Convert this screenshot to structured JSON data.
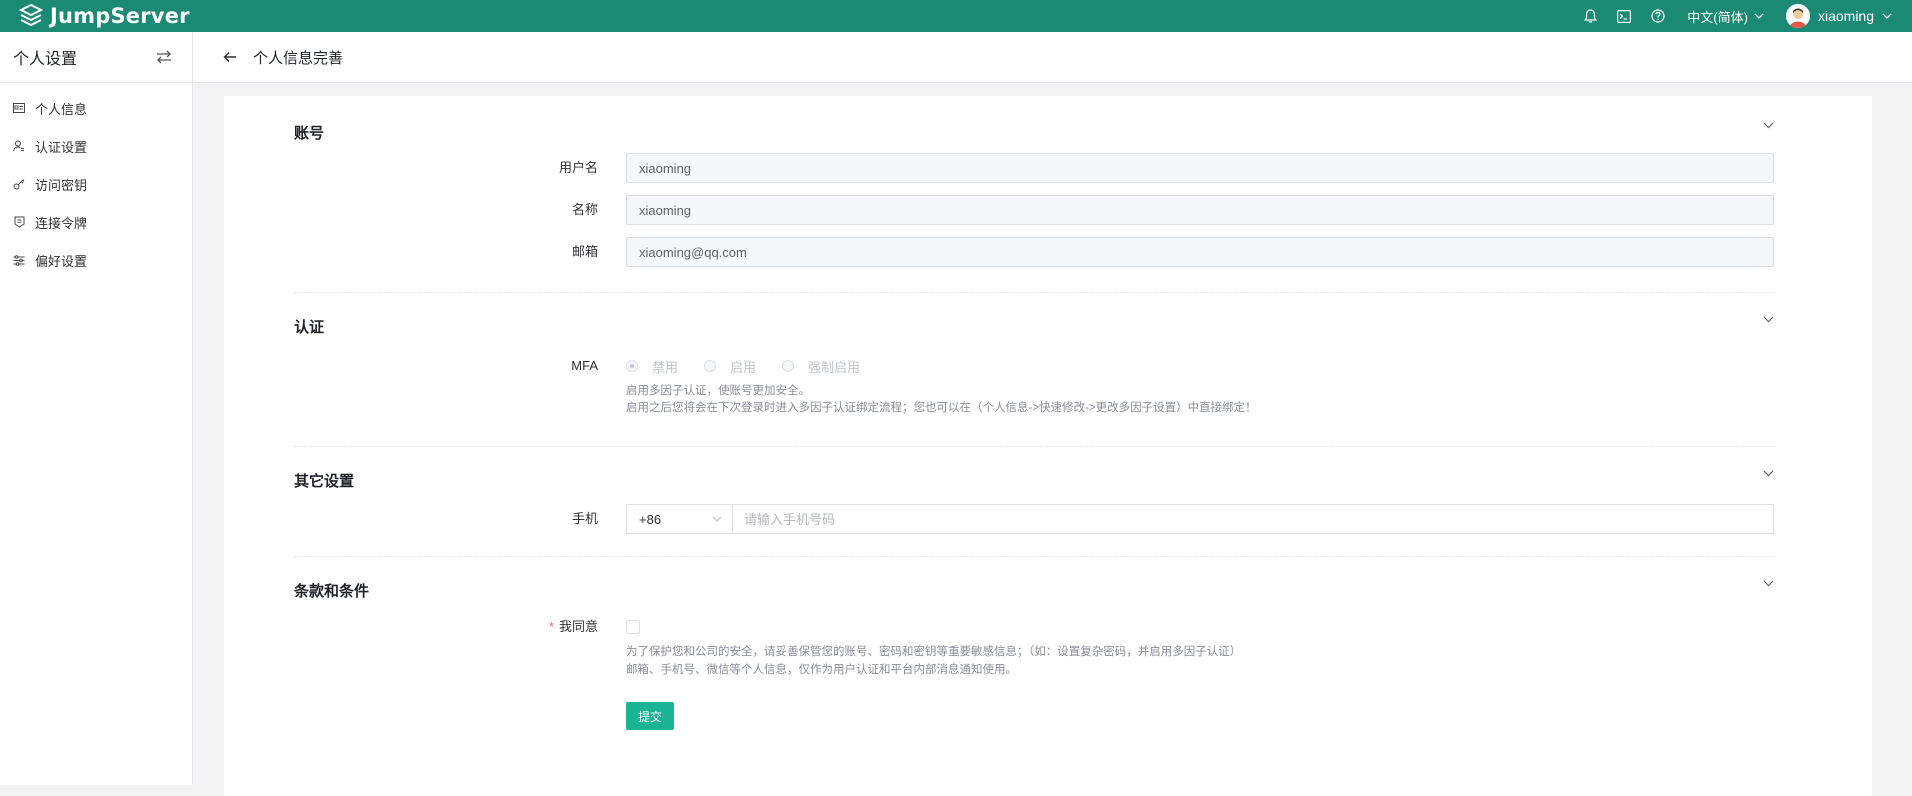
{
  "topbar": {
    "brand": "JumpServer",
    "icons": [
      "bell-icon",
      "terminal-icon",
      "help-icon"
    ],
    "language": "中文(简体)",
    "username": "xiaoming",
    "bg_color": "#1a8a74"
  },
  "sidebar": {
    "title": "个人设置",
    "items": [
      {
        "label": "个人信息",
        "icon": "id-card-icon"
      },
      {
        "label": "认证设置",
        "icon": "user-shield-icon"
      },
      {
        "label": "访问密钥",
        "icon": "key-icon"
      },
      {
        "label": "连接令牌",
        "icon": "token-icon"
      },
      {
        "label": "偏好设置",
        "icon": "sliders-icon"
      }
    ]
  },
  "page": {
    "title": "个人信息完善"
  },
  "sections": {
    "account": {
      "title": "账号",
      "fields": {
        "username": {
          "label": "用户名",
          "value": "xiaoming"
        },
        "name": {
          "label": "名称",
          "value": "xiaoming"
        },
        "email": {
          "label": "邮箱",
          "value": "xiaoming@qq.com"
        }
      }
    },
    "auth": {
      "title": "认证",
      "mfa_label": "MFA",
      "options": [
        "禁用",
        "启用",
        "强制启用"
      ],
      "selected": "禁用",
      "help_line1": "启用多因子认证，使账号更加安全。",
      "help_line2": "启用之后您将会在下次登录时进入多因子认证绑定流程；您也可以在（个人信息->快速修改->更改多因子设置）中直接绑定！"
    },
    "other": {
      "title": "其它设置",
      "phone_label": "手机",
      "country_code": "+86",
      "phone_placeholder": "请输入手机号码"
    },
    "terms": {
      "title": "条款和条件",
      "agree_required_mark": "*",
      "agree_label": "我同意",
      "agree_checked": false,
      "help_line1": "为了保护您和公司的安全，请妥善保管您的账号、密码和密钥等重要敏感信息；（如：设置复杂密码，并启用多因子认证）",
      "help_line2": "邮箱、手机号、微信等个人信息，仅作为用户认证和平台内部消息通知使用。"
    }
  },
  "submit_label": "提交",
  "accent_color": "#1ab394"
}
